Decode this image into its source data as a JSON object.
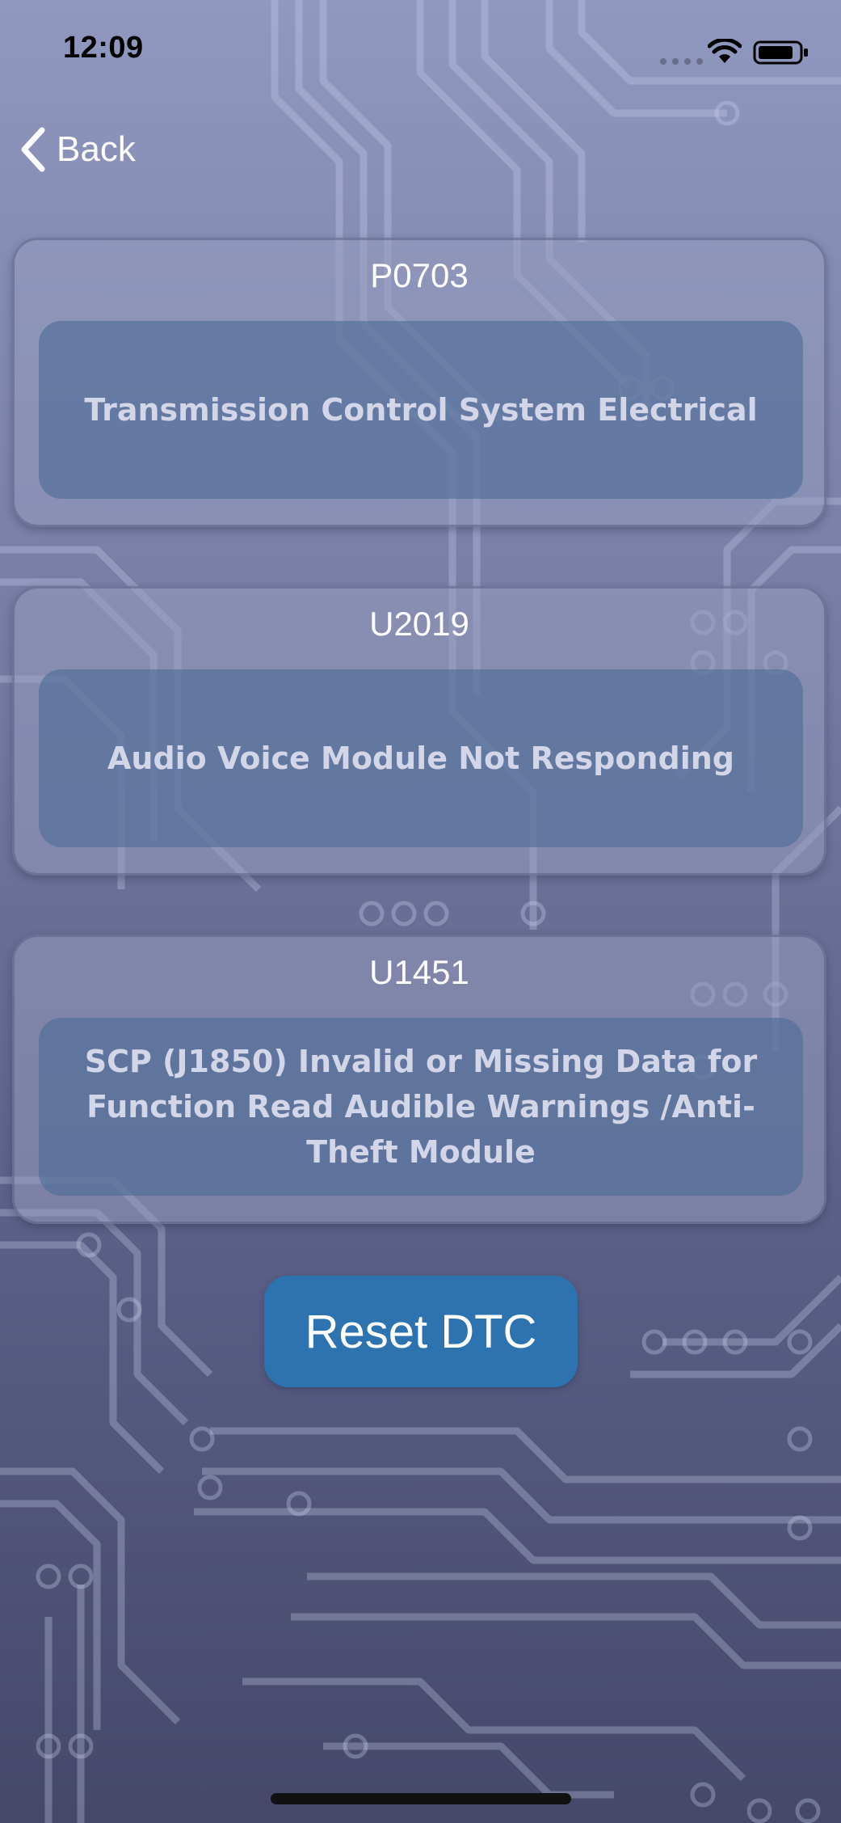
{
  "status_bar": {
    "time": "12:09",
    "icons": [
      "signal-dots-icon",
      "wifi-icon",
      "battery-icon"
    ]
  },
  "nav": {
    "back_label": "Back",
    "back_icon": "chevron-left-icon"
  },
  "dtc_list": [
    {
      "code": "P0703",
      "description": "Transmission Control System Electrical"
    },
    {
      "code": "U2019",
      "description": "Audio Voice Module Not Responding"
    },
    {
      "code": "U1451",
      "description": "SCP (J1850) Invalid or Missing Data for Function Read Audible Warnings /Anti-Theft Module"
    }
  ],
  "actions": {
    "reset_label": "Reset DTC"
  },
  "colors": {
    "background_top": "#8f98bf",
    "background_bottom": "#454869",
    "card_fill": "#969cbe",
    "description_fill": "#4e6c96",
    "reset_button": "#2d73b0"
  }
}
